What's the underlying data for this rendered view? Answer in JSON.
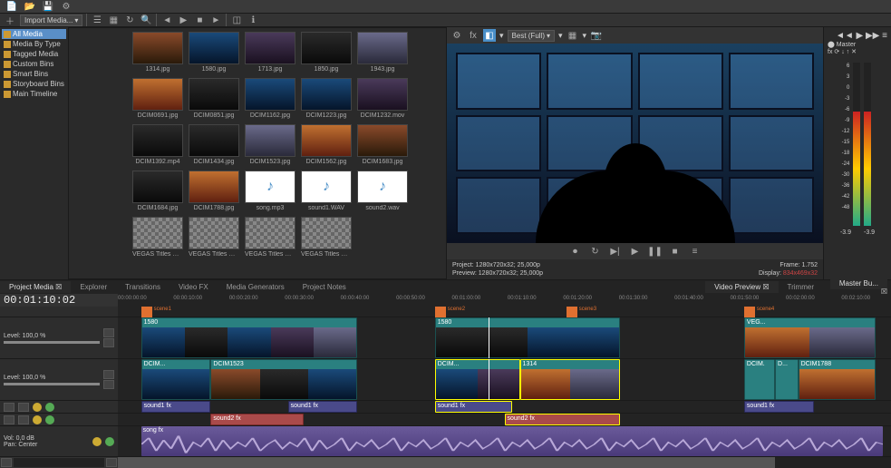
{
  "toolbar": {
    "importLabel": "Import Media...",
    "bestLabel": "Best (Full)"
  },
  "bins": {
    "items": [
      {
        "label": "All Media",
        "sel": true
      },
      {
        "label": "Media By Type",
        "sel": false
      },
      {
        "label": "Tagged Media",
        "sel": false
      },
      {
        "label": "Custom Bins",
        "sel": false
      },
      {
        "label": "Smart Bins",
        "sel": false
      },
      {
        "label": "Storyboard Bins",
        "sel": false
      },
      {
        "label": "Main Timeline",
        "sel": false
      }
    ]
  },
  "media": {
    "thumbs": [
      {
        "label": "1314.jpg",
        "cls": "t1"
      },
      {
        "label": "1580.jpg",
        "cls": "t2"
      },
      {
        "label": "1713.jpg",
        "cls": "t3"
      },
      {
        "label": "1850.jpg",
        "cls": "t4"
      },
      {
        "label": "1943.jpg",
        "cls": "t5"
      },
      {
        "label": "DCIM0691.jpg",
        "cls": "t6"
      },
      {
        "label": "DCIM0851.jpg",
        "cls": "t4"
      },
      {
        "label": "DCIM1162.jpg",
        "cls": "t2"
      },
      {
        "label": "DCIM1223.jpg",
        "cls": "t2"
      },
      {
        "label": "DCIM1232.mov",
        "cls": "t3"
      },
      {
        "label": "DCIM1392.mp4",
        "cls": "t4"
      },
      {
        "label": "DCIM1434.jpg",
        "cls": "t4"
      },
      {
        "label": "DCIM1523.jpg",
        "cls": "t5"
      },
      {
        "label": "DCIM1562.jpg",
        "cls": "t6"
      },
      {
        "label": "DCIM1683.jpg",
        "cls": "t1"
      },
      {
        "label": "DCIM1684.jpg",
        "cls": "t4"
      },
      {
        "label": "DCIM1788.jpg",
        "cls": "t6"
      },
      {
        "label": "song.mp3",
        "cls": "audio"
      },
      {
        "label": "sound1.WAV",
        "cls": "audio"
      },
      {
        "label": "sound2.wav",
        "cls": "audio"
      },
      {
        "label": "VEGAS Titles & Text abstract",
        "cls": "checker"
      },
      {
        "label": "VEGAS Titles & Text dark",
        "cls": "checker"
      },
      {
        "label": "VEGAS Titles & Text dark and bright",
        "cls": "checker"
      },
      {
        "label": "VEGAS Titles & Text The magic of light",
        "cls": "checker"
      }
    ]
  },
  "tabsLeft": [
    "Project Media",
    "Explorer",
    "Transitions",
    "Video FX",
    "Media Generators",
    "Project Notes"
  ],
  "tabsRight": [
    "Video Preview",
    "Trimmer"
  ],
  "tabsMaster": "Master Bu...",
  "preview": {
    "infoProject": "Project:   1280x720x32; 25,000p",
    "infoPreview": "Preview:  1280x720x32; 25,000p",
    "infoFrame": "Frame:   1.752",
    "infoDisplay": "Display:  ",
    "infoDisplayVal": "834x469x32",
    "masterLabel": "Master",
    "meterL": "-3.9",
    "meterR": "-3.9",
    "scaleTop": "6",
    "scale0": "0"
  },
  "timeline": {
    "timecode": "00:01:10:02",
    "markers": [
      {
        "label": "scene1",
        "pct": 3
      },
      {
        "label": "scene2",
        "pct": 41
      },
      {
        "label": "scene3",
        "pct": 58
      },
      {
        "label": "scene4",
        "pct": 81
      }
    ],
    "ticks": [
      "00:00:00:00",
      "00:00:10:00",
      "00:00:20:00",
      "00:00:30:00",
      "00:00:40:00",
      "00:00:50:00",
      "00:01:00:00",
      "00:01:10:00",
      "00:01:20:00",
      "00:01:30:00",
      "00:01:40:00",
      "00:01:50:00",
      "00:02:00:00",
      "00:02:10:00"
    ],
    "trackLevels": {
      "v1": "Level: 100,0 %",
      "v2": "Level: 100,0 %",
      "vol": "Vol:      0,0 dB",
      "pan": "Pan:     Center"
    },
    "clips": {
      "v1a": "1580",
      "v1b": "1580",
      "v1c": "VEG...",
      "v2a": "DCIM...",
      "v2b": "DCIM1523",
      "v2c": "DCIM...",
      "v2d": "1314",
      "v2e": "DCIM.",
      "v2f": "D...",
      "v2g": "DCIM1788",
      "a1a": "sound1",
      "a1b": "sound1",
      "a1c": "sound1",
      "a1d": "sound1",
      "a2a": "sound2",
      "a2b": "sound2",
      "songa": "song"
    }
  }
}
